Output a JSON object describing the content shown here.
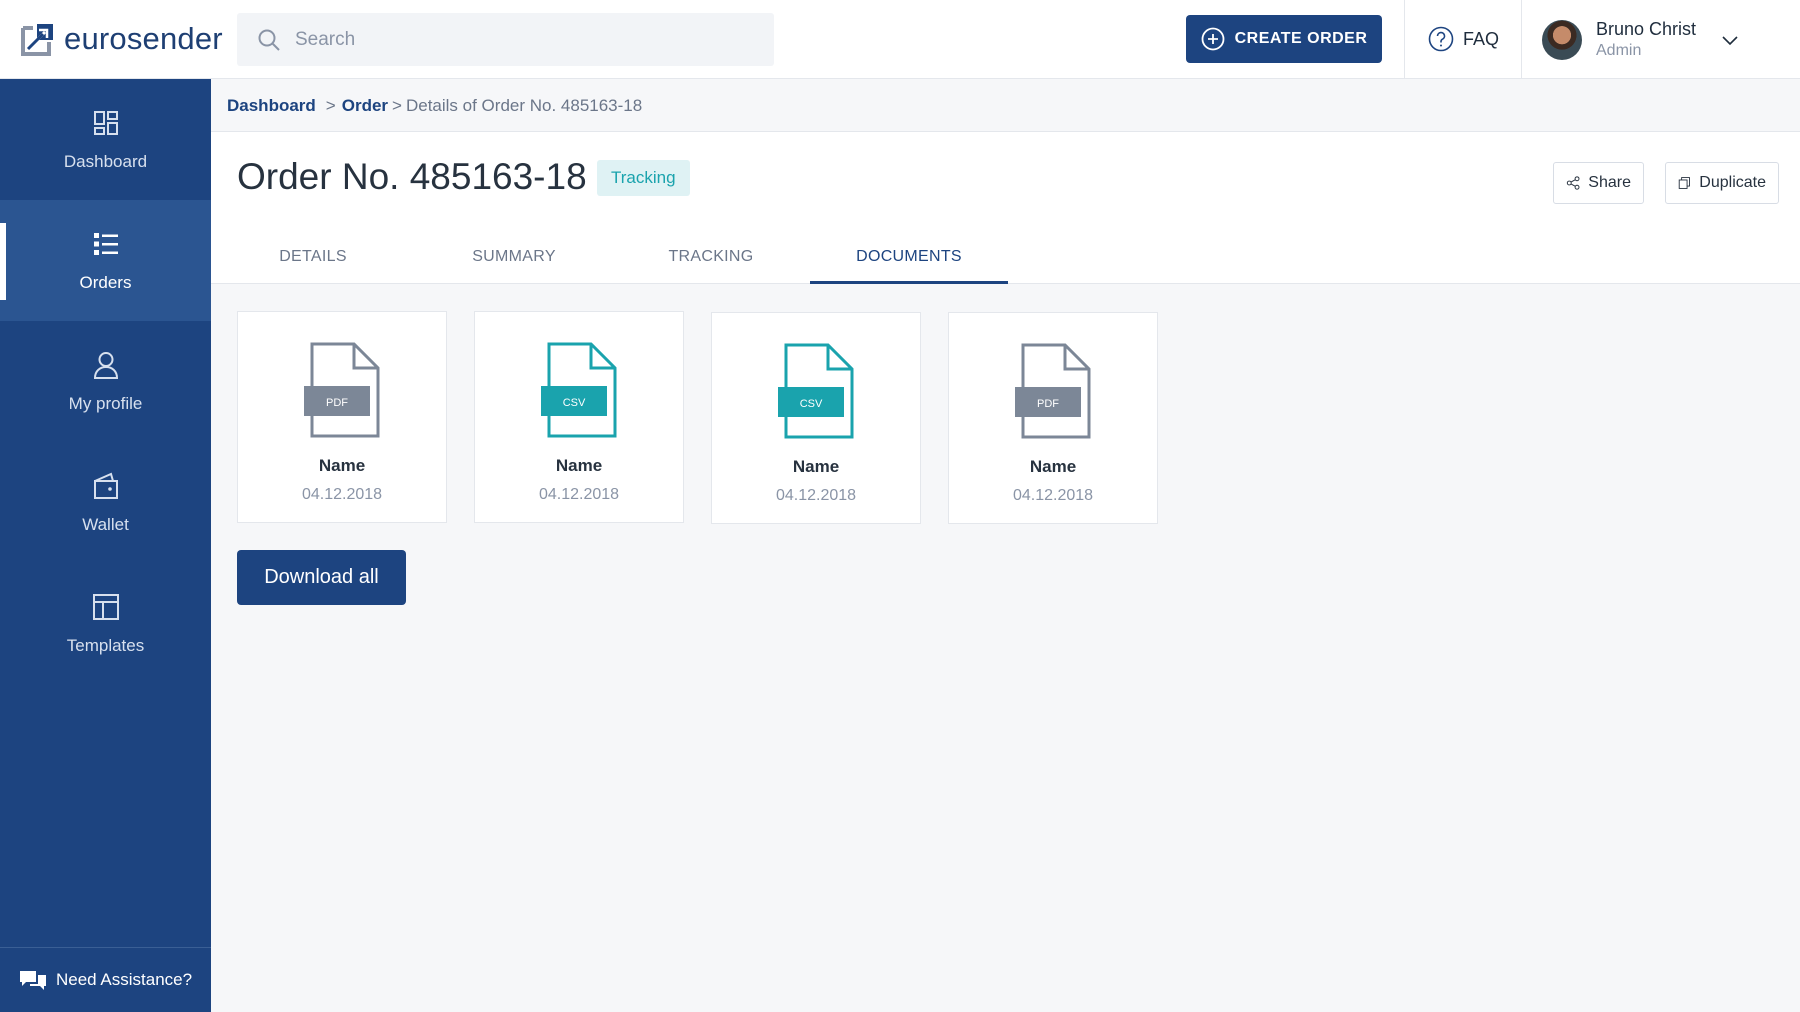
{
  "brand": {
    "name": "eurosender",
    "accent": "#1d4480",
    "teal": "#1aa3ad"
  },
  "search": {
    "placeholder": "Search",
    "value": ""
  },
  "header": {
    "create_order_label": "CREATE ORDER",
    "faq_label": "FAQ",
    "user": {
      "name": "Bruno Christ",
      "role": "Admin"
    }
  },
  "sidebar": {
    "items": [
      {
        "label": "Dashboard",
        "icon": "dashboard-icon",
        "active": false
      },
      {
        "label": "Orders",
        "icon": "orders-list-icon",
        "active": true
      },
      {
        "label": "My profile",
        "icon": "user-icon",
        "active": false
      },
      {
        "label": "Wallet",
        "icon": "wallet-icon",
        "active": false
      },
      {
        "label": "Templates",
        "icon": "templates-icon",
        "active": false
      }
    ],
    "assist_label": "Need Assistance?"
  },
  "breadcrumb": {
    "home": "Dashboard",
    "sep1": ">",
    "order": "Order",
    "sep2": ">",
    "current": "Details of Order No. 485163-18"
  },
  "order": {
    "title": "Order No. 485163-18",
    "status": "Tracking",
    "share_label": "Share",
    "duplicate_label": "Duplicate"
  },
  "tabs": [
    {
      "label": "DETAILS",
      "active": false
    },
    {
      "label": "SUMMARY",
      "active": false
    },
    {
      "label": "TRACKING",
      "active": false
    },
    {
      "label": "DOCUMENTS",
      "active": true
    }
  ],
  "documents": [
    {
      "type": "PDF",
      "name": "Name",
      "date": "04.12.2018"
    },
    {
      "type": "CSV",
      "name": "Name",
      "date": "04.12.2018"
    },
    {
      "type": "CSV",
      "name": "Name",
      "date": "04.12.2018"
    },
    {
      "type": "PDF",
      "name": "Name",
      "date": "04.12.2018"
    }
  ],
  "download_all_label": "Download all"
}
